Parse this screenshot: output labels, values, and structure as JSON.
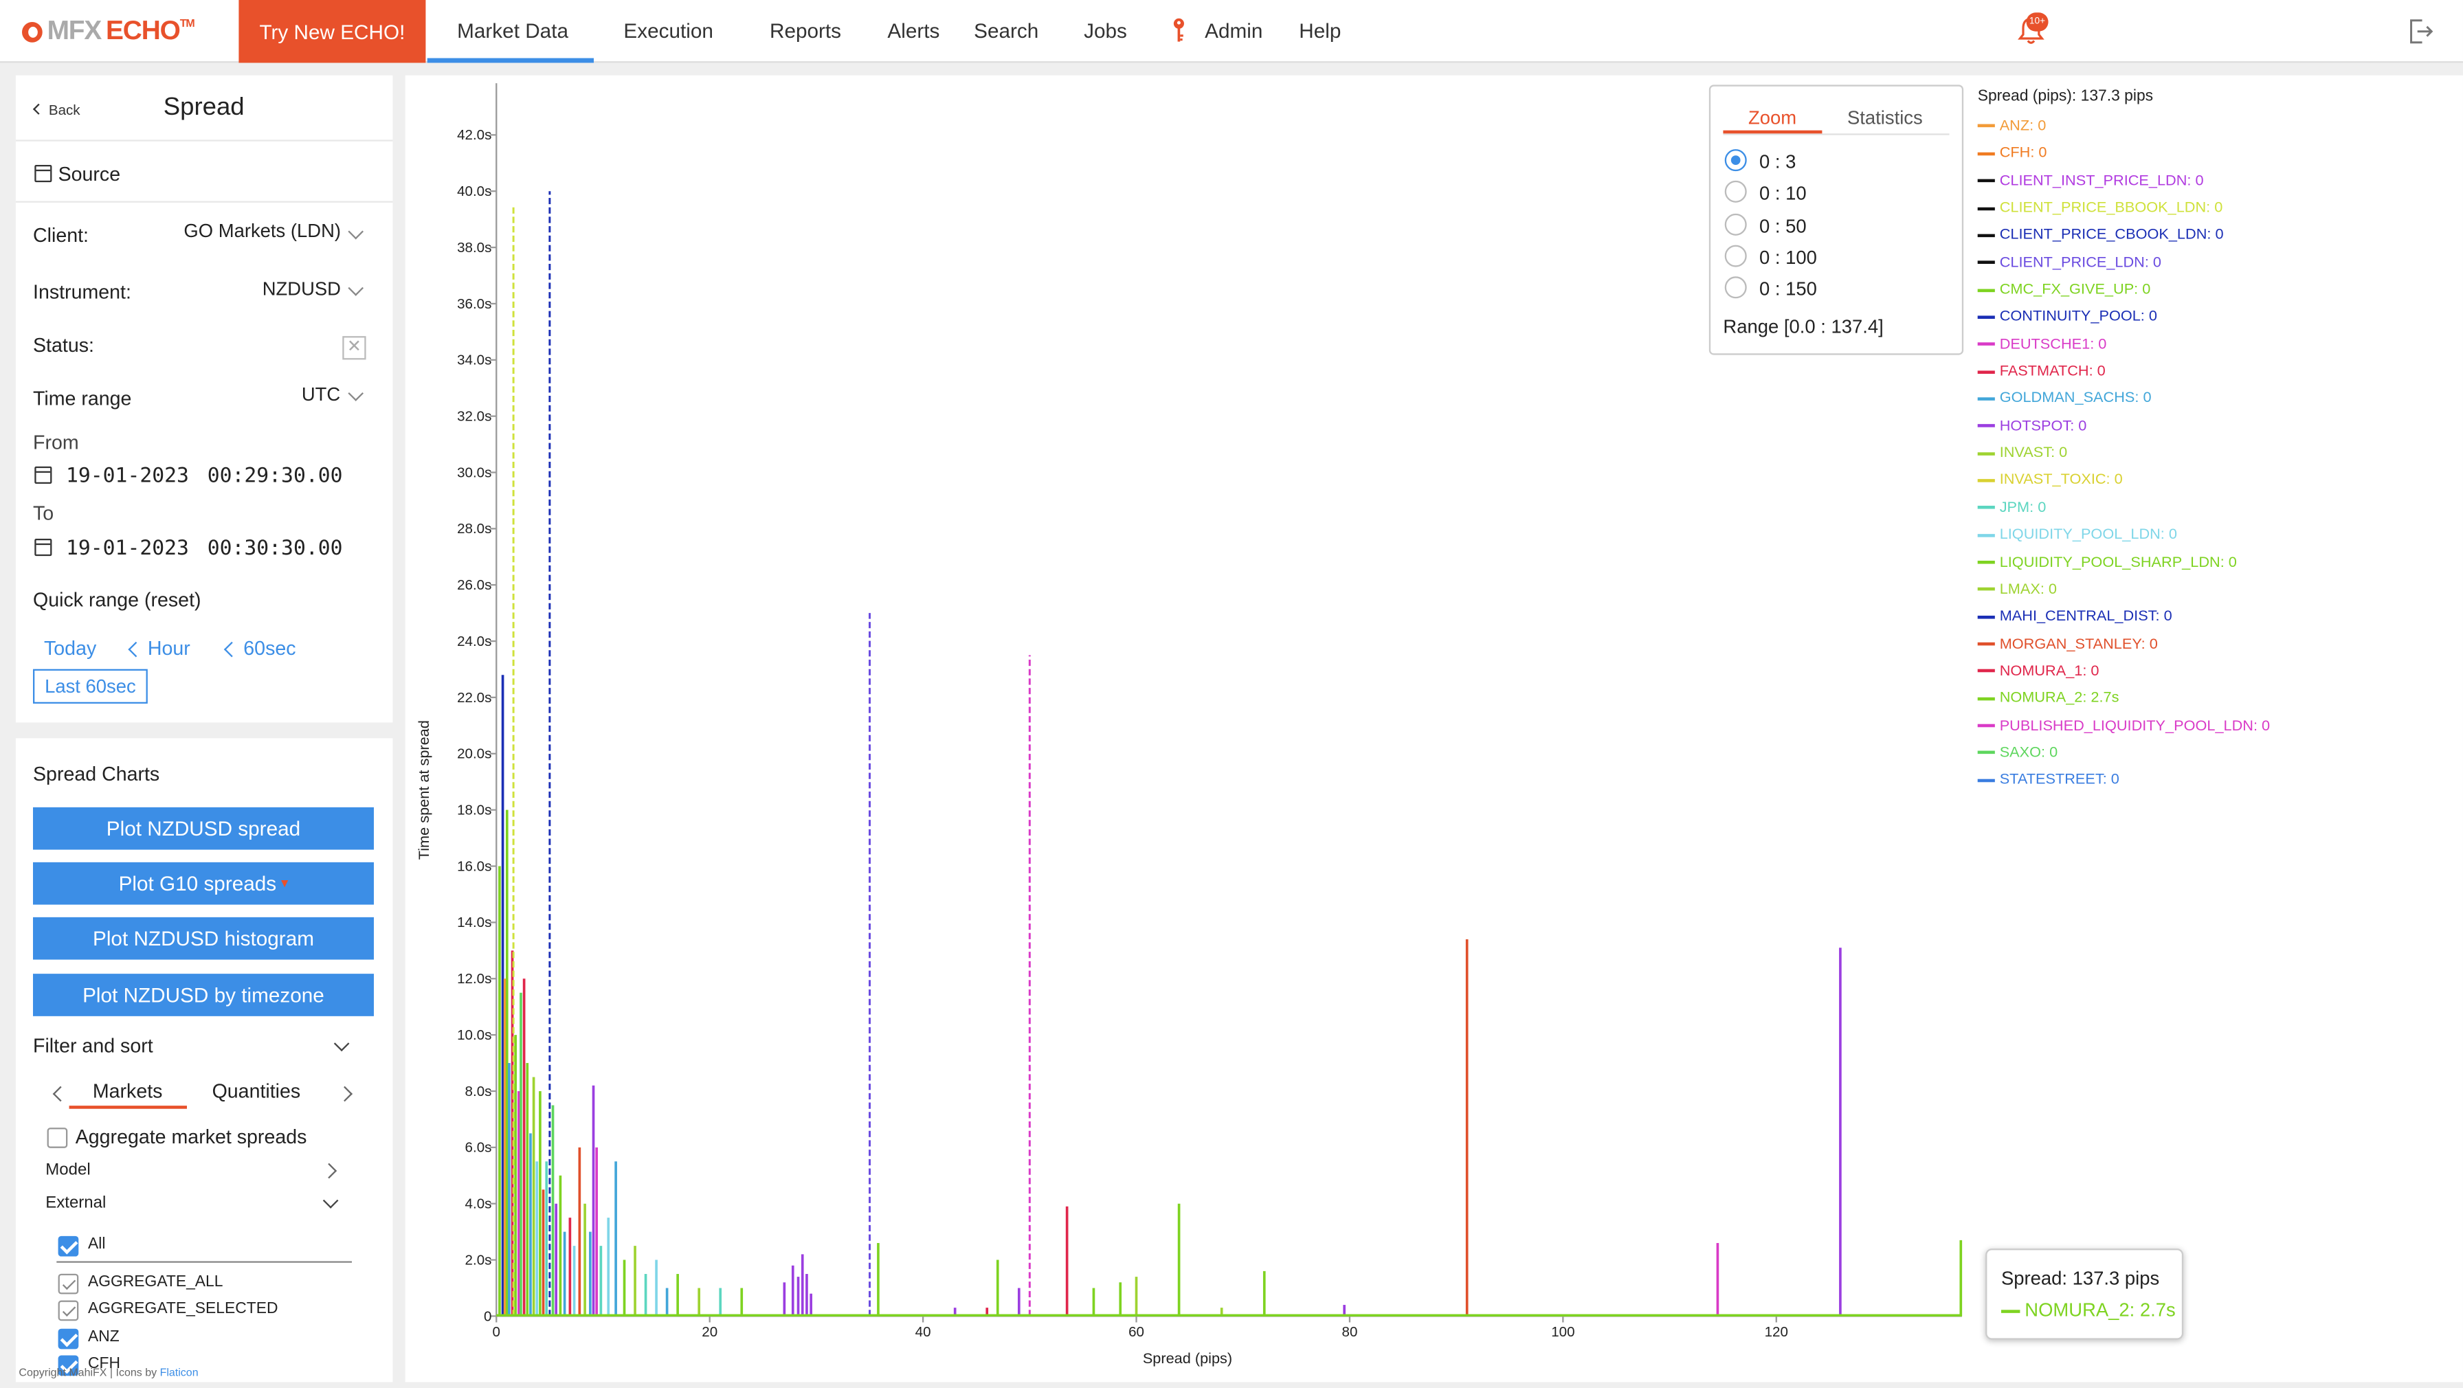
{
  "nav": {
    "logo_mfx": "MFX",
    "logo_echo": "ECHO",
    "logo_tm": "TM",
    "try_button": "Try New ECHO!",
    "items": [
      "Market Data",
      "Execution",
      "Reports",
      "Alerts",
      "Search",
      "Jobs",
      "Admin",
      "Help"
    ],
    "active": "Market Data",
    "notification_badge": "10+"
  },
  "sidebar": {
    "back_label": "Back",
    "title": "Spread",
    "source_label": "Source",
    "client_label": "Client:",
    "client_value": "GO Markets (LDN)",
    "instrument_label": "Instrument:",
    "instrument_value": "NZDUSD",
    "status_label": "Status:",
    "time_range_label": "Time range",
    "timezone_value": "UTC",
    "from_label": "From",
    "from_date": "19-01-2023",
    "from_time": "00:29:30.00",
    "to_label": "To",
    "to_date": "19-01-2023",
    "to_time": "00:30:30.00",
    "quick_range_label": "Quick range (reset)",
    "quick_today": "Today",
    "quick_hour": "Hour",
    "quick_60sec": "60sec",
    "quick_last60": "Last 60sec"
  },
  "charts_panel": {
    "title": "Spread Charts",
    "buttons": [
      "Plot NZDUSD spread",
      "Plot G10 spreads",
      "Plot NZDUSD histogram",
      "Plot NZDUSD by timezone"
    ],
    "filter_sort_label": "Filter and sort",
    "tabs": [
      "Markets",
      "Quantities"
    ],
    "aggregate_label": "Aggregate market spreads",
    "model_label": "Model",
    "external_label": "External",
    "all_label": "All",
    "checkbox_items": [
      {
        "label": "AGGREGATE_ALL",
        "checked": false
      },
      {
        "label": "AGGREGATE_SELECTED",
        "checked": false
      },
      {
        "label": "ANZ",
        "checked": true
      },
      {
        "label": "CFH",
        "checked": true
      }
    ]
  },
  "footer": {
    "copyright": "Copyright MahiFX | Icons by ",
    "flaticon": "Flaticon"
  },
  "zoom_panel": {
    "tab_zoom": "Zoom",
    "tab_statistics": "Statistics",
    "options": [
      "0 : 3",
      "0 : 10",
      "0 : 50",
      "0 : 100",
      "0 : 150"
    ],
    "selected_index": 0,
    "range_text": "Range [0.0 : 137.4]"
  },
  "legend": {
    "title": "Spread (pips): 137.3 pips",
    "items": [
      {
        "label": "ANZ: 0",
        "color": "#f29b38",
        "dashed": false
      },
      {
        "label": "CFH: 0",
        "color": "#f07b21",
        "dashed": false
      },
      {
        "label": "CLIENT_INST_PRICE_LDN: 0",
        "color": "#b13be0",
        "dashed": true
      },
      {
        "label": "CLIENT_PRICE_BBOOK_LDN: 0",
        "color": "#cfe13b",
        "dashed": true
      },
      {
        "label": "CLIENT_PRICE_CBOOK_LDN: 0",
        "color": "#1b2fb5",
        "dashed": true
      },
      {
        "label": "CLIENT_PRICE_LDN: 0",
        "color": "#6a4be0",
        "dashed": true
      },
      {
        "label": "CMC_FX_GIVE_UP: 0",
        "color": "#7ed321",
        "dashed": false
      },
      {
        "label": "CONTINUITY_POOL: 0",
        "color": "#1b2fb5",
        "dashed": false
      },
      {
        "label": "DEUTSCHE1: 0",
        "color": "#d93bc7",
        "dashed": false
      },
      {
        "label": "FASTMATCH: 0",
        "color": "#e0264b",
        "dashed": false
      },
      {
        "label": "GOLDMAN_SACHS: 0",
        "color": "#42a6d9",
        "dashed": false
      },
      {
        "label": "HOTSPOT: 0",
        "color": "#9b3ee0",
        "dashed": false
      },
      {
        "label": "INVAST: 0",
        "color": "#9ed331",
        "dashed": false
      },
      {
        "label": "INVAST_TOXIC: 0",
        "color": "#d9d131",
        "dashed": false
      },
      {
        "label": "JPM: 0",
        "color": "#5cd6c0",
        "dashed": false
      },
      {
        "label": "LIQUIDITY_POOL_LDN: 0",
        "color": "#7fd6e8",
        "dashed": false
      },
      {
        "label": "LIQUIDITY_POOL_SHARP_LDN: 0",
        "color": "#7ed321",
        "dashed": false
      },
      {
        "label": "LMAX: 0",
        "color": "#9ed331",
        "dashed": false
      },
      {
        "label": "MAHI_CENTRAL_DIST: 0",
        "color": "#1b2fb5",
        "dashed": false
      },
      {
        "label": "MORGAN_STANLEY: 0",
        "color": "#e0502b",
        "dashed": false
      },
      {
        "label": "NOMURA_1: 0",
        "color": "#e0264b",
        "dashed": false
      },
      {
        "label": "NOMURA_2: 2.7s",
        "color": "#7ed321",
        "dashed": false
      },
      {
        "label": "PUBLISHED_LIQUIDITY_POOL_LDN: 0",
        "color": "#d93bc7",
        "dashed": false
      },
      {
        "label": "SAXO: 0",
        "color": "#5ed65e",
        "dashed": false
      },
      {
        "label": "STATESTREET: 0",
        "color": "#3a7de0",
        "dashed": false
      }
    ]
  },
  "tooltip": {
    "title": "Spread: 137.3 pips",
    "series": "NOMURA_2: 2.7s"
  },
  "chart_data": {
    "type": "bar",
    "xlabel": "Spread (pips)",
    "ylabel": "Time spent at spread",
    "xlim": [
      0,
      137.4
    ],
    "ylim": [
      0,
      43
    ],
    "x_ticks": [
      "0",
      "20",
      "40",
      "60",
      "80",
      "100",
      "120"
    ],
    "y_ticks": [
      "0",
      "2.0s",
      "4.0s",
      "6.0s",
      "8.0s",
      "10.0s",
      "12.0s",
      "14.0s",
      "16.0s",
      "18.0s",
      "20.0s",
      "22.0s",
      "24.0s",
      "26.0s",
      "28.0s",
      "30.0s",
      "32.0s",
      "34.0s",
      "36.0s",
      "38.0s",
      "40.0s",
      "42.0s"
    ],
    "dashed_series": [
      {
        "x": 1.6,
        "y": 39.5,
        "color": "#cfe13b"
      },
      {
        "x": 5.0,
        "y": 40.0,
        "color": "#1b2fb5"
      },
      {
        "x": 35.0,
        "y": 25.0,
        "color": "#6a4be0"
      },
      {
        "x": 50.0,
        "y": 23.5,
        "color": "#d93bc7"
      }
    ],
    "bars": [
      {
        "x": 0.3,
        "y": 16.0,
        "color": "#7ed321"
      },
      {
        "x": 0.6,
        "y": 22.8,
        "color": "#1b2fb5"
      },
      {
        "x": 0.8,
        "y": 12.0,
        "color": "#f29b38"
      },
      {
        "x": 1.0,
        "y": 18.0,
        "color": "#7ed321"
      },
      {
        "x": 1.2,
        "y": 9.0,
        "color": "#42a6d9"
      },
      {
        "x": 1.5,
        "y": 13.0,
        "color": "#e0264b"
      },
      {
        "x": 1.8,
        "y": 10.0,
        "color": "#7ed321"
      },
      {
        "x": 2.1,
        "y": 8.0,
        "color": "#d93bc7"
      },
      {
        "x": 2.3,
        "y": 11.5,
        "color": "#5ed65e"
      },
      {
        "x": 2.6,
        "y": 12.0,
        "color": "#e0264b"
      },
      {
        "x": 2.9,
        "y": 9.0,
        "color": "#7ed321"
      },
      {
        "x": 3.2,
        "y": 6.5,
        "color": "#42a6d9"
      },
      {
        "x": 3.5,
        "y": 8.5,
        "color": "#9ed331"
      },
      {
        "x": 3.8,
        "y": 5.5,
        "color": "#7fd6e8"
      },
      {
        "x": 4.1,
        "y": 8.0,
        "color": "#7ed321"
      },
      {
        "x": 4.4,
        "y": 4.5,
        "color": "#e0502b"
      },
      {
        "x": 4.7,
        "y": 5.5,
        "color": "#5cd6c0"
      },
      {
        "x": 5.3,
        "y": 7.5,
        "color": "#5ed65e"
      },
      {
        "x": 5.6,
        "y": 4.0,
        "color": "#9b3ee0"
      },
      {
        "x": 6.0,
        "y": 5.0,
        "color": "#7ed321"
      },
      {
        "x": 6.4,
        "y": 3.0,
        "color": "#42a6d9"
      },
      {
        "x": 6.9,
        "y": 3.5,
        "color": "#e0264b"
      },
      {
        "x": 7.3,
        "y": 2.5,
        "color": "#7fd6e8"
      },
      {
        "x": 7.8,
        "y": 6.0,
        "color": "#e0502b"
      },
      {
        "x": 8.3,
        "y": 4.0,
        "color": "#9ed331"
      },
      {
        "x": 8.8,
        "y": 3.0,
        "color": "#42a6d9"
      },
      {
        "x": 9.1,
        "y": 8.2,
        "color": "#9b3ee0"
      },
      {
        "x": 9.4,
        "y": 6.0,
        "color": "#d93bc7"
      },
      {
        "x": 9.8,
        "y": 2.5,
        "color": "#5cd6c0"
      },
      {
        "x": 10.5,
        "y": 3.5,
        "color": "#7fd6e8"
      },
      {
        "x": 11.2,
        "y": 5.5,
        "color": "#42a6d9"
      },
      {
        "x": 12.0,
        "y": 2.0,
        "color": "#7ed321"
      },
      {
        "x": 13.0,
        "y": 2.5,
        "color": "#9ed331"
      },
      {
        "x": 14.0,
        "y": 1.5,
        "color": "#5cd6c0"
      },
      {
        "x": 15.0,
        "y": 2.0,
        "color": "#7fd6e8"
      },
      {
        "x": 16.0,
        "y": 1.0,
        "color": "#42a6d9"
      },
      {
        "x": 17.0,
        "y": 1.5,
        "color": "#7ed321"
      },
      {
        "x": 19.0,
        "y": 1.0,
        "color": "#9ed331"
      },
      {
        "x": 21.0,
        "y": 1.0,
        "color": "#5cd6c0"
      },
      {
        "x": 23.0,
        "y": 1.0,
        "color": "#7ed321"
      },
      {
        "x": 27.0,
        "y": 1.2,
        "color": "#9b3ee0"
      },
      {
        "x": 27.8,
        "y": 1.8,
        "color": "#9b3ee0"
      },
      {
        "x": 28.3,
        "y": 1.4,
        "color": "#9b3ee0"
      },
      {
        "x": 28.7,
        "y": 2.2,
        "color": "#9b3ee0"
      },
      {
        "x": 29.1,
        "y": 1.5,
        "color": "#9b3ee0"
      },
      {
        "x": 29.5,
        "y": 0.8,
        "color": "#9b3ee0"
      },
      {
        "x": 35.8,
        "y": 2.6,
        "color": "#7ed321"
      },
      {
        "x": 43.0,
        "y": 0.3,
        "color": "#9b3ee0"
      },
      {
        "x": 46.0,
        "y": 0.3,
        "color": "#e0264b"
      },
      {
        "x": 47.0,
        "y": 2.0,
        "color": "#7ed321"
      },
      {
        "x": 49.0,
        "y": 1.0,
        "color": "#9b3ee0"
      },
      {
        "x": 53.5,
        "y": 3.9,
        "color": "#e0264b"
      },
      {
        "x": 56.0,
        "y": 1.0,
        "color": "#7ed321"
      },
      {
        "x": 58.5,
        "y": 1.2,
        "color": "#7ed321"
      },
      {
        "x": 60.0,
        "y": 1.4,
        "color": "#9ed331"
      },
      {
        "x": 64.0,
        "y": 4.0,
        "color": "#7ed321"
      },
      {
        "x": 68.0,
        "y": 0.3,
        "color": "#9ed331"
      },
      {
        "x": 72.0,
        "y": 1.6,
        "color": "#7ed321"
      },
      {
        "x": 79.5,
        "y": 0.4,
        "color": "#9b3ee0"
      },
      {
        "x": 91.0,
        "y": 13.4,
        "color": "#e0502b"
      },
      {
        "x": 114.5,
        "y": 2.6,
        "color": "#d93bc7"
      },
      {
        "x": 126.0,
        "y": 13.1,
        "color": "#9b3ee0"
      },
      {
        "x": 137.3,
        "y": 2.7,
        "color": "#7ed321"
      }
    ]
  }
}
